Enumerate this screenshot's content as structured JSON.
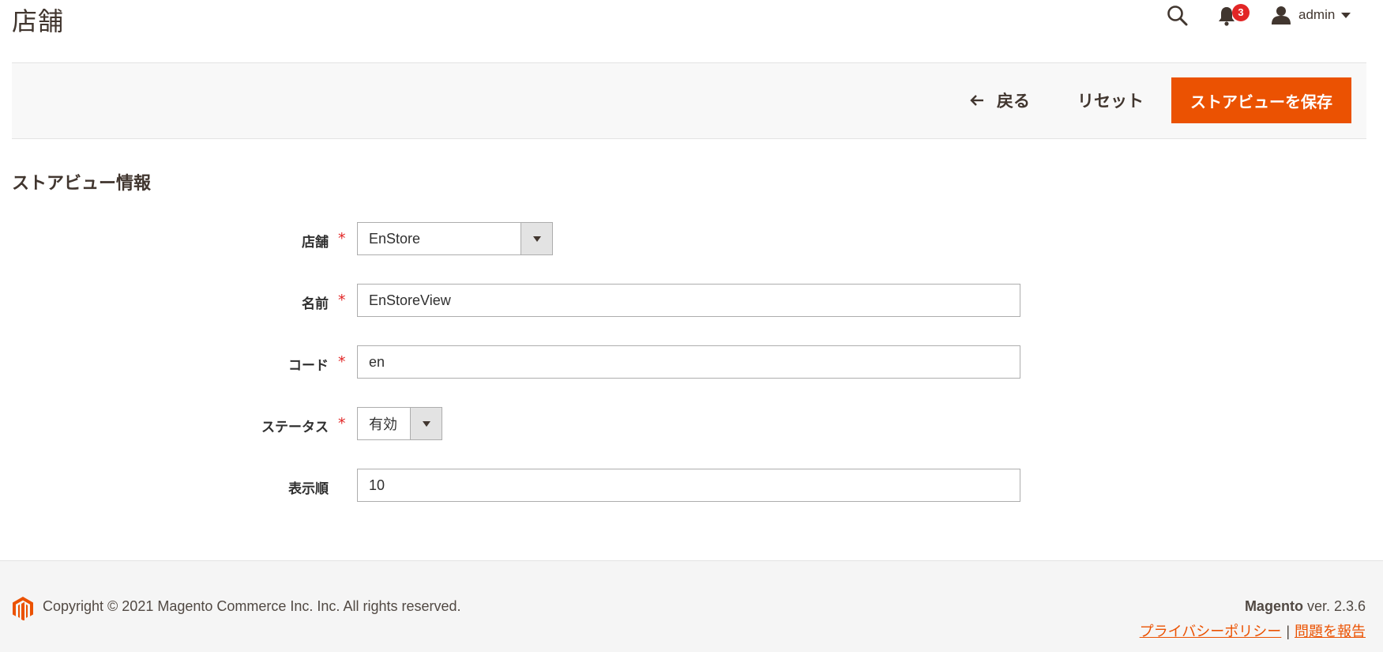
{
  "header": {
    "title": "店舗",
    "notification_count": "3",
    "user_name": "admin"
  },
  "actions": {
    "back_label": "戻る",
    "reset_label": "リセット",
    "save_label": "ストアビューを保存"
  },
  "section": {
    "title": "ストアビュー情報"
  },
  "form": {
    "store": {
      "label": "店舗",
      "required": "*",
      "value": "EnStore"
    },
    "name": {
      "label": "名前",
      "required": "*",
      "value": "EnStoreView"
    },
    "code": {
      "label": "コード",
      "required": "*",
      "value": "en"
    },
    "status": {
      "label": "ステータス",
      "required": "*",
      "value": "有効"
    },
    "sort_order": {
      "label": "表示順",
      "value": "10"
    }
  },
  "footer": {
    "copyright": "Copyright © 2021 Magento Commerce Inc. Inc. All rights reserved.",
    "brand": "Magento",
    "version": " ver. 2.3.6",
    "privacy_link": "プライバシーポリシー",
    "separator": "|",
    "report_link": "問題を報告"
  },
  "colors": {
    "accent": "#eb5202",
    "badge": "#e22626",
    "required": "#e22626"
  }
}
